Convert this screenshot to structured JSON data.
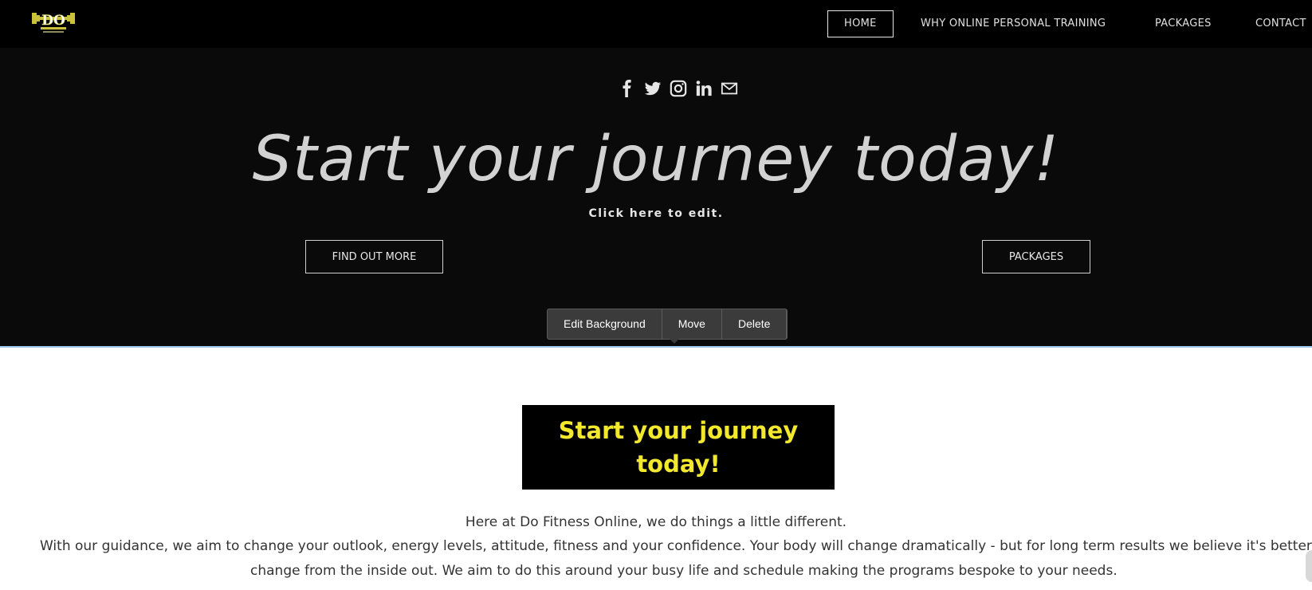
{
  "header": {
    "logo_icon": "do-fitness-logo",
    "nav": [
      {
        "label": "HOME",
        "active": true
      },
      {
        "label": "WHY ONLINE PERSONAL TRAINING",
        "active": false
      },
      {
        "label": "PACKAGES",
        "active": false
      },
      {
        "label": "CONTACT",
        "active": false
      }
    ]
  },
  "hero": {
    "social_icons": [
      "facebook-icon",
      "twitter-icon",
      "instagram-icon",
      "linkedin-icon",
      "mail-icon"
    ],
    "title": "Start your journey today!",
    "subtitle": "Click here to edit.",
    "find_out_more": "FIND OUT MORE",
    "packages_button": "PACKAGES"
  },
  "toolbar": {
    "edit_background": "Edit Background",
    "move": "Move",
    "delete": "Delete"
  },
  "content": {
    "promo_line1": "Start your journey",
    "promo_line2": "today!",
    "intro": "Here at Do Fitness Online, we do things a little different.",
    "paragraph_line1": "With our guidance,  we aim to change your outlook, energy levels, attitude, fitness and your confidence. Your body will change dramatically -  but for long term results we believe it's better to",
    "paragraph_line2": "change from the inside out. We aim to do this around your busy life and schedule making the programs bespoke to your needs."
  },
  "colors": {
    "header_bg": "#000000",
    "hero_bg": "#0a0a0a",
    "accent_yellow": "#f2e82c",
    "toolbar_bg": "#3b3b3b"
  }
}
